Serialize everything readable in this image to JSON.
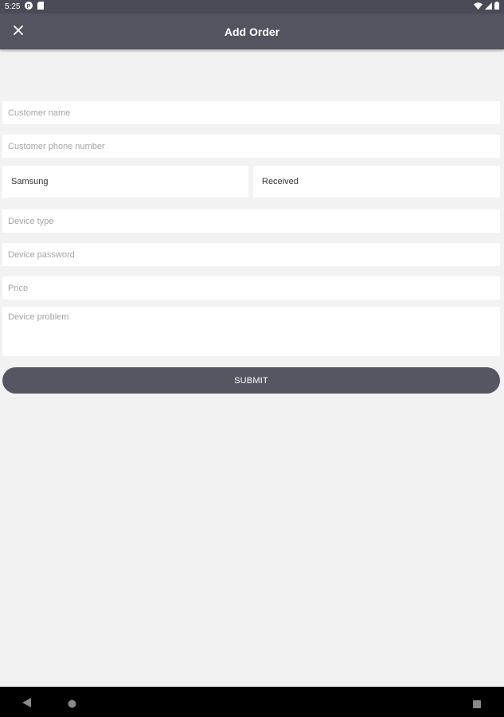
{
  "status_bar": {
    "time": "5:25"
  },
  "app_bar": {
    "title": "Add Order",
    "close_icon": "close-icon"
  },
  "form": {
    "customer_name": {
      "placeholder": "Customer name",
      "value": ""
    },
    "customer_phone": {
      "placeholder": "Customer phone number",
      "value": ""
    },
    "brand": {
      "selected": "Samsung"
    },
    "status": {
      "selected": "Received"
    },
    "device_type": {
      "placeholder": "Device type",
      "value": ""
    },
    "device_password": {
      "placeholder": "Device password",
      "value": ""
    },
    "price": {
      "placeholder": "Price",
      "value": ""
    },
    "device_problem": {
      "placeholder": "Device problem",
      "value": ""
    },
    "submit_label": "SUBMIT"
  },
  "colors": {
    "app_bar": "#545461",
    "status_bar": "#4a4a57",
    "background": "#f2f2f2",
    "button": "#565662"
  }
}
